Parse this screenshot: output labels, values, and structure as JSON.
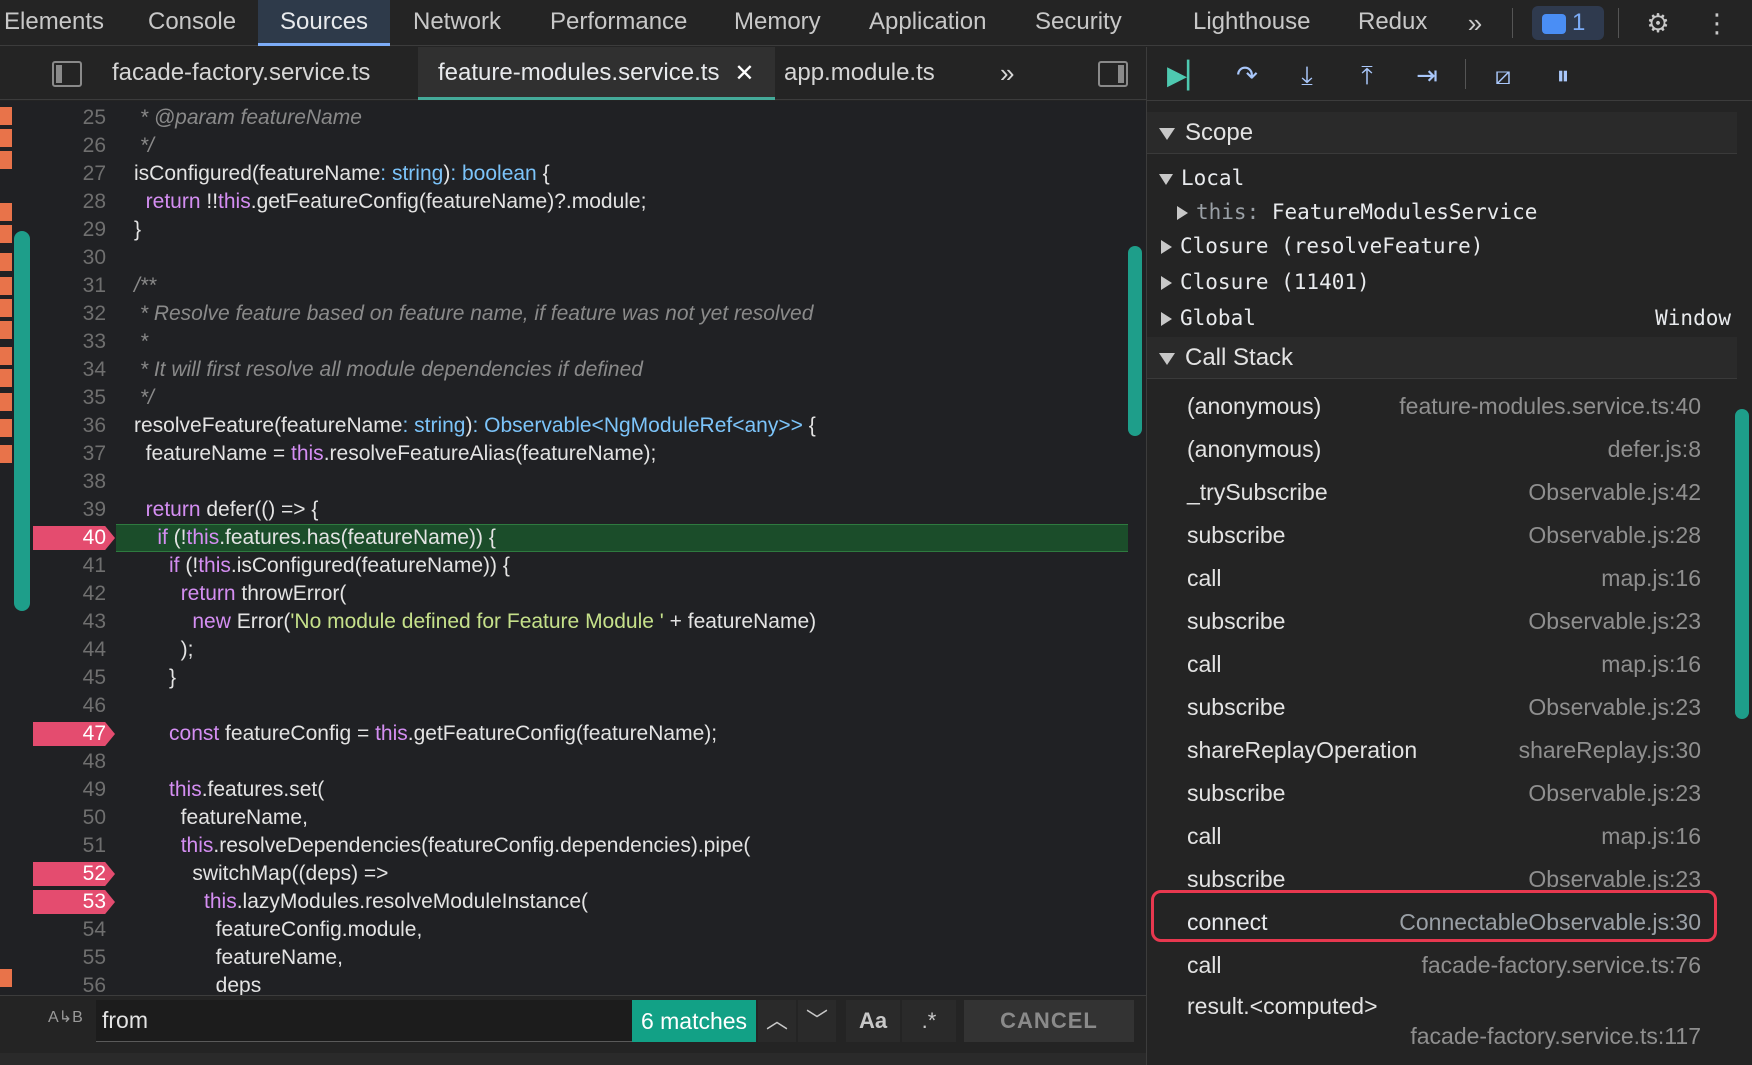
{
  "top_tabs": [
    "Elements",
    "Console",
    "Sources",
    "Network",
    "Performance",
    "Memory",
    "Application",
    "Security",
    "Lighthouse",
    "Redux"
  ],
  "active_top_tab": "Sources",
  "more_tabs_glyph": "»",
  "issues_count": "1",
  "file_tabs": [
    "facade-factory.service.ts",
    "feature-modules.service.ts",
    "app.module.ts"
  ],
  "active_file_tab": "feature-modules.service.ts",
  "file_tab_close": "✕",
  "file_tabs_more": "»",
  "code_lines": [
    {
      "n": "25",
      "html": "<span class=\"cm\"> * @param featureName</span>"
    },
    {
      "n": "26",
      "html": "<span class=\"cm\"> */</span>"
    },
    {
      "n": "27",
      "html": "isConfigured(featureName<span class=\"ty\">: string</span>)<span class=\"ty\">: boolean</span> {"
    },
    {
      "n": "28",
      "html": "  <span class=\"kw\">return</span> !!<span class=\"th\">this</span>.getFeatureConfig(featureName)?.module;"
    },
    {
      "n": "29",
      "html": "}"
    },
    {
      "n": "30",
      "html": ""
    },
    {
      "n": "31",
      "html": "<span class=\"cm\">/**</span>"
    },
    {
      "n": "32",
      "html": "<span class=\"cm\"> * Resolve feature based on feature name, if feature was not yet resolved</span>"
    },
    {
      "n": "33",
      "html": "<span class=\"cm\"> *</span>"
    },
    {
      "n": "34",
      "html": "<span class=\"cm\"> * It will first resolve all module dependencies if defined</span>"
    },
    {
      "n": "35",
      "html": "<span class=\"cm\"> */</span>"
    },
    {
      "n": "36",
      "html": "resolveFeature(featureName<span class=\"ty\">: string</span>)<span class=\"ty\">: Observable&lt;NgModuleRef&lt;any&gt;&gt;</span> {"
    },
    {
      "n": "37",
      "html": "  featureName = <span class=\"th\">this</span>.resolveFeatureAlias(featureName);"
    },
    {
      "n": "38",
      "html": ""
    },
    {
      "n": "39",
      "html": "  <span class=\"kw\">return</span> defer(() =&gt; {"
    },
    {
      "n": "40",
      "html": "    <span class=\"kw\">if</span> (!<span class=\"th\">this</span>.features.has(featureName)) {",
      "bp": true,
      "exec": true
    },
    {
      "n": "41",
      "html": "      <span class=\"kw\">if</span> (!<span class=\"th\">this</span>.isConfigured(featureName)) {"
    },
    {
      "n": "42",
      "html": "        <span class=\"kw\">return</span> throwError("
    },
    {
      "n": "43",
      "html": "          <span class=\"kw\">new</span> Error(<span class=\"st\">'No module defined for Feature Module '</span> + featureName)"
    },
    {
      "n": "44",
      "html": "        );"
    },
    {
      "n": "45",
      "html": "      }"
    },
    {
      "n": "46",
      "html": ""
    },
    {
      "n": "47",
      "html": "      <span class=\"kw\">const</span> featureConfig = <span class=\"th\">this</span>.getFeatureConfig(featureName);",
      "bp": true
    },
    {
      "n": "48",
      "html": ""
    },
    {
      "n": "49",
      "html": "      <span class=\"th\">this</span>.features.set("
    },
    {
      "n": "50",
      "html": "        featureName,"
    },
    {
      "n": "51",
      "html": "        <span class=\"th\">this</span>.resolveDependencies(featureConfig.dependencies).pipe("
    },
    {
      "n": "52",
      "html": "          switchMap((deps) =&gt;",
      "bp": true
    },
    {
      "n": "53",
      "html": "            <span class=\"th\">this</span>.lazyModules.resolveModuleInstance(",
      "bp": true
    },
    {
      "n": "54",
      "html": "              featureConfig.module,"
    },
    {
      "n": "55",
      "html": "              featureName,"
    },
    {
      "n": "56",
      "html": "              deps"
    }
  ],
  "search": {
    "value": "from",
    "matches": "6 matches",
    "case_label": "Aa",
    "regex_label": ".*",
    "cancel": "CANCEL",
    "case_icon_label": "A↳B"
  },
  "scope": {
    "title": "Scope",
    "local_label": "Local",
    "this_label": "this: ",
    "this_value": "FeatureModulesService",
    "closure1": "Closure (resolveFeature)",
    "closure2": "Closure (11401)",
    "global_label": "Global",
    "global_value": "Window"
  },
  "call_stack": {
    "title": "Call Stack",
    "frames": [
      {
        "fn": "(anonymous)",
        "loc": "feature-modules.service.ts:40"
      },
      {
        "fn": "(anonymous)",
        "loc": "defer.js:8"
      },
      {
        "fn": "_trySubscribe",
        "loc": "Observable.js:42"
      },
      {
        "fn": "subscribe",
        "loc": "Observable.js:28"
      },
      {
        "fn": "call",
        "loc": "map.js:16"
      },
      {
        "fn": "subscribe",
        "loc": "Observable.js:23"
      },
      {
        "fn": "call",
        "loc": "map.js:16"
      },
      {
        "fn": "subscribe",
        "loc": "Observable.js:23"
      },
      {
        "fn": "shareReplayOperation",
        "loc": "shareReplay.js:30"
      },
      {
        "fn": "subscribe",
        "loc": "Observable.js:23"
      },
      {
        "fn": "call",
        "loc": "map.js:16"
      },
      {
        "fn": "subscribe",
        "loc": "Observable.js:23"
      },
      {
        "fn": "connect",
        "loc": "ConnectableObservable.js:30"
      },
      {
        "fn": "call",
        "loc": "facade-factory.service.ts:76"
      },
      {
        "fn": "result.<computed>",
        "loc": "facade-factory.service.ts:117"
      }
    ]
  }
}
